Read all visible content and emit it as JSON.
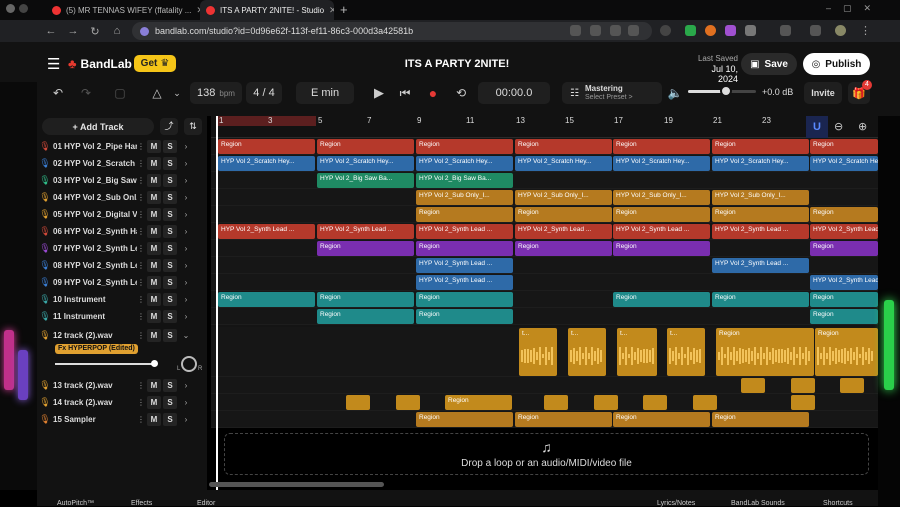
{
  "browser": {
    "tabs": [
      {
        "label": "(5) MR TENNAS WIFEY (ffatality ...",
        "active": false
      },
      {
        "label": "ITS A PARTY 2NITE! - Studio",
        "active": true
      }
    ],
    "url": "bandlab.com/studio?id=0d96e62f-113f-ef11-86c3-000d3a42581b"
  },
  "header": {
    "brand": "BandLab",
    "get_label": "Get",
    "project_title": "ITS A PARTY 2NITE!",
    "last_saved_label": "Last Saved",
    "last_saved_date": "Jul 10, 2024",
    "save_label": "Save",
    "publish_label": "Publish"
  },
  "transport": {
    "bpm": "138",
    "bpm_unit": "bpm",
    "time_sig": "4 / 4",
    "key": "E min",
    "time": "00:00.0",
    "mastering_label": "Mastering",
    "mastering_preset": "Select Preset >",
    "volume_db": "+0.0 dB",
    "invite_label": "Invite",
    "notif_count": "4"
  },
  "sidebar": {
    "add_track_label": "+ Add Track",
    "tracks": [
      {
        "num": "01",
        "name": "HYP Vol 2_Pipe Har...",
        "color": "#d44a3a"
      },
      {
        "num": "02",
        "name": "HYP Vol 2_Scratch ...",
        "color": "#3a7ed4"
      },
      {
        "num": "03",
        "name": "HYP Vol 2_Big Saw ...",
        "color": "#2fbf8a"
      },
      {
        "num": "04",
        "name": "HYP Vol 2_Sub Onl...",
        "color": "#e0a030"
      },
      {
        "num": "05",
        "name": "HYP Vol 2_Digital V...",
        "color": "#e0a030"
      },
      {
        "num": "06",
        "name": "HYP Vol 2_Synth Har...",
        "color": "#d44a3a"
      },
      {
        "num": "07",
        "name": "HYP Vol 2_Synth Le...",
        "color": "#9b4ad4"
      },
      {
        "num": "08",
        "name": "HYP Vol 2_Synth Le...",
        "color": "#3a7ed4"
      },
      {
        "num": "09",
        "name": "HYP Vol 2_Synth Le...",
        "color": "#3a7ed4"
      },
      {
        "num": "10",
        "name": "Instrument",
        "color": "#3aa8a8"
      },
      {
        "num": "11",
        "name": "Instrument",
        "color": "#3aa8a8"
      },
      {
        "num": "12",
        "name": "track (2).wav",
        "color": "#e0a030"
      },
      {
        "num": "13",
        "name": "track (2).wav",
        "color": "#e0a030"
      },
      {
        "num": "14",
        "name": "track (2).wav",
        "color": "#e0a030"
      },
      {
        "num": "15",
        "name": "Sampler",
        "color": "#e08030"
      }
    ],
    "mute_label": "M",
    "solo_label": "S",
    "fx_label": "Fx HYPERPOP (Edited)",
    "pan_l": "L",
    "pan_r": "R"
  },
  "ruler": {
    "ticks": [
      "1",
      "3",
      "5",
      "7",
      "9",
      "11",
      "13",
      "15",
      "17",
      "19",
      "21",
      "23"
    ]
  },
  "lanes": {
    "region_label": "Region",
    "r02": "HYP Vol 2_Scratch Hey...",
    "r03": "HYP Vol 2_Big Saw Ba...",
    "r04": "HYP Vol 2_Sub Only_I...",
    "r06": "HYP Vol 2_Synth Lead ...",
    "r06_last": "HYP Vol 2_Synth Lead ..",
    "r08": "HYP Vol 2_Synth Lead ...",
    "r09": "HYP Vol 2_Synth Lead ...",
    "wav_t": "t..."
  },
  "drop": {
    "text": "Drop a loop or an audio/MIDI/video file"
  },
  "bottom": {
    "items": [
      "AutoPitch™",
      "Effects",
      "Editor",
      "Lyrics/Notes",
      "BandLab Sounds",
      "Shortcuts"
    ]
  },
  "colors": {
    "red": "#b5392b",
    "blue": "#2e6aa8",
    "green": "#1f8a63",
    "orange": "#b57a1f",
    "gold": "#c28a1c",
    "purple": "#7a2eb0",
    "teal": "#1f8a8a",
    "waveform": "#c9902a"
  }
}
